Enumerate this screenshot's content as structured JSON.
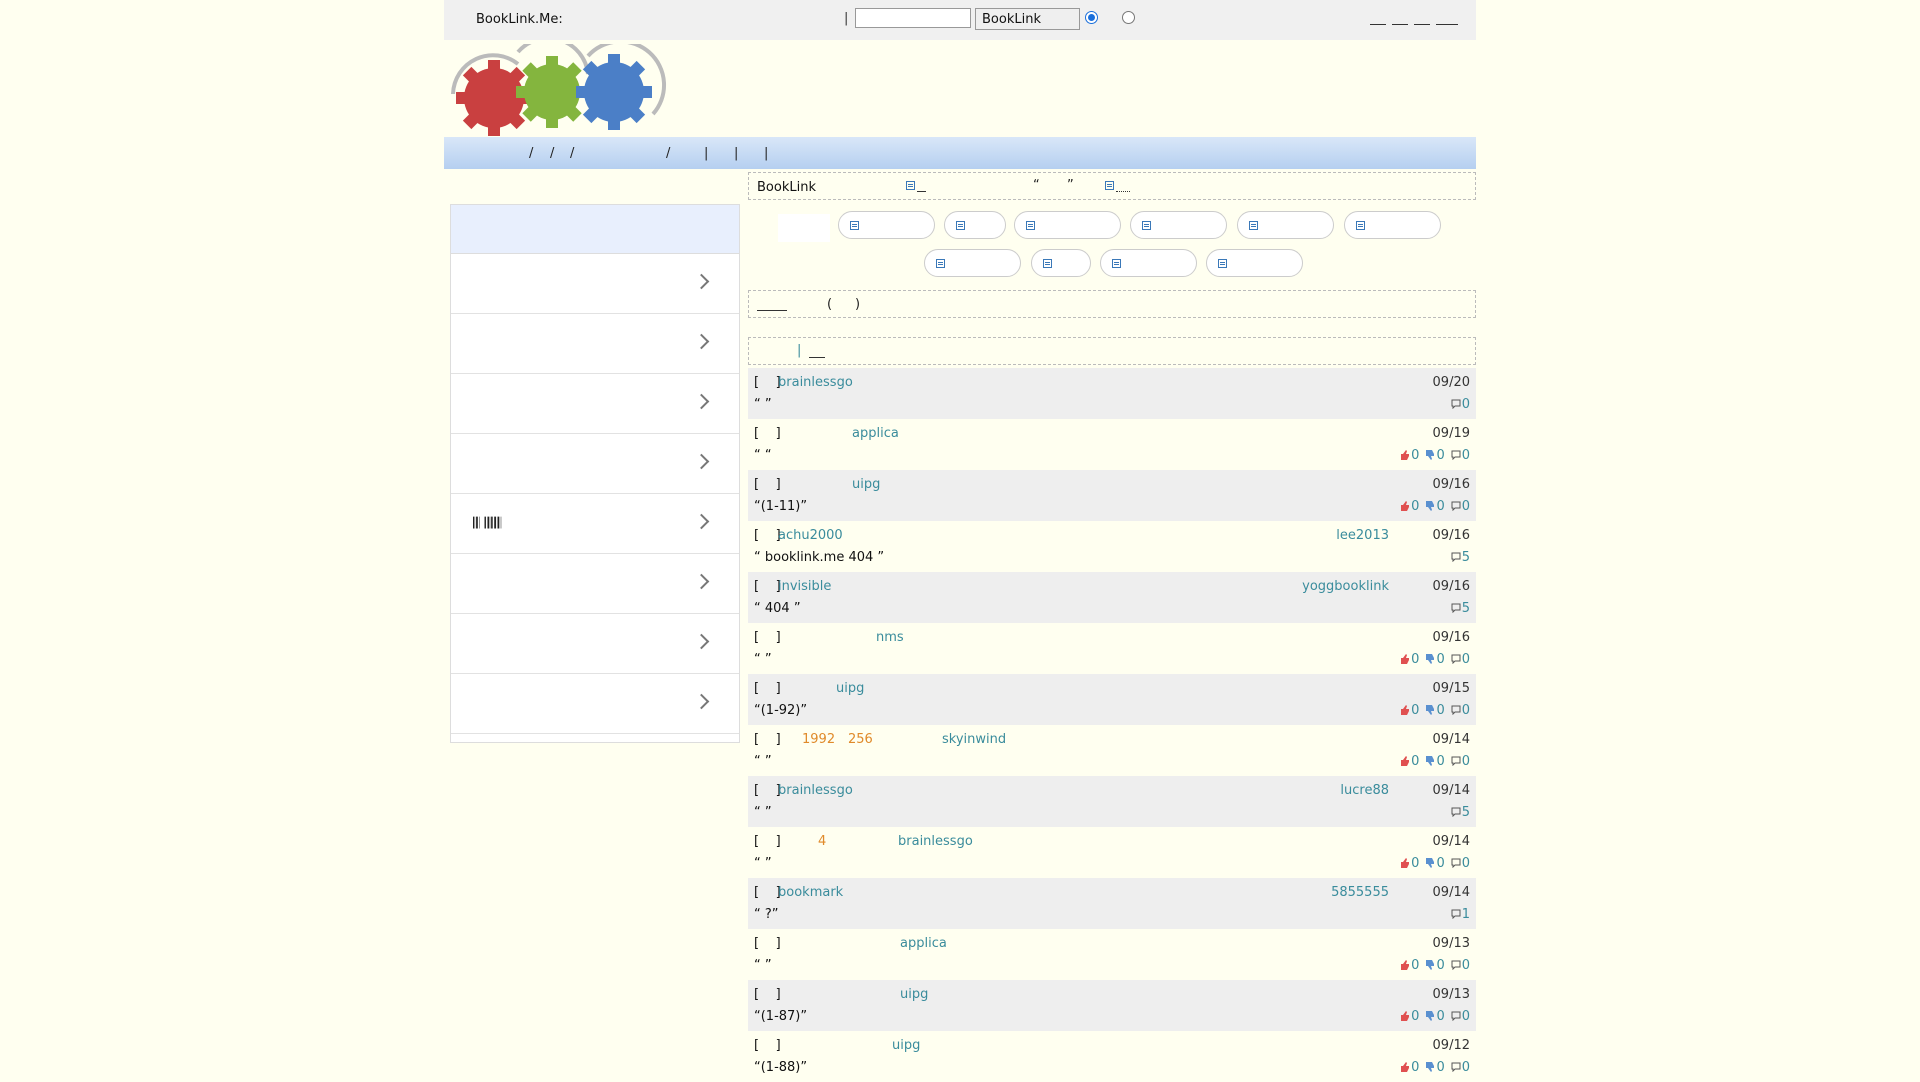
{
  "topbar": {
    "site_label": "BookLink.Me:",
    "separator": "|",
    "search_value": "",
    "search_button": "BookLink"
  },
  "notice": {
    "text": "BookLink"
  },
  "sidebar": {
    "items": [
      {
        "label": ""
      },
      {
        "label": ""
      },
      {
        "label": ""
      },
      {
        "label": ""
      },
      {
        "label": "𝄃𝄃 𝄃𝄃𝄃𝄃𝄃"
      },
      {
        "label": ""
      },
      {
        "label": ""
      },
      {
        "label": ""
      }
    ]
  },
  "list": [
    {
      "user_a": "brainlessgo",
      "user_b": "",
      "date": "09/20",
      "quote": "“                          ”",
      "votes": false,
      "up": "",
      "down": "",
      "comments": "0"
    },
    {
      "user_a": "applica",
      "user_b": "",
      "date": "09/19",
      "quote": "“      “",
      "votes": true,
      "up": "0",
      "down": "0",
      "comments": "0"
    },
    {
      "user_a": "uipg",
      "user_b": "",
      "date": "09/16",
      "quote": "“(1-11)”",
      "votes": true,
      "up": "0",
      "down": "0",
      "comments": "0"
    },
    {
      "user_a": "achu2000",
      "user_b": "lee2013",
      "date": "09/16",
      "quote": "“        booklink.me                    404     ”",
      "votes": false,
      "up": "",
      "down": "",
      "comments": "5"
    },
    {
      "user_a": "invisible",
      "user_b": "yoggbooklink",
      "date": "09/16",
      "quote": "“      404                              ”",
      "votes": false,
      "up": "",
      "down": "",
      "comments": "5"
    },
    {
      "user_a": "nms",
      "user_b": "",
      "date": "09/16",
      "quote": "“                                            ”",
      "votes": true,
      "up": "0",
      "down": "0",
      "comments": "0"
    },
    {
      "user_a": "uipg",
      "user_b": "",
      "date": "09/15",
      "quote": "“(1-92)”",
      "votes": true,
      "up": "0",
      "down": "0",
      "comments": "0"
    },
    {
      "user_a": "skyinwind",
      "user_b": "",
      "date": "09/14",
      "quote": "“        ”",
      "votes": true,
      "up": "0",
      "down": "0",
      "comments": "0",
      "orange1": "1992",
      "orange2": "256"
    },
    {
      "user_a": "brainlessgo",
      "user_b": "lucre88",
      "date": "09/14",
      "quote": "“                ”",
      "votes": false,
      "up": "",
      "down": "",
      "comments": "5"
    },
    {
      "user_a": "brainlessgo",
      "user_b": "",
      "date": "09/14",
      "quote": "“                                                            ”",
      "votes": true,
      "up": "0",
      "down": "0",
      "comments": "0",
      "orange1": "4"
    },
    {
      "user_a": "bookmark",
      "user_b": "5855555",
      "date": "09/14",
      "quote": "“                   ?”",
      "votes": false,
      "up": "",
      "down": "",
      "comments": "1"
    },
    {
      "user_a": "applica",
      "user_b": "",
      "date": "09/13",
      "quote": "“                                    ”",
      "votes": true,
      "up": "0",
      "down": "0",
      "comments": "0"
    },
    {
      "user_a": "uipg",
      "user_b": "",
      "date": "09/13",
      "quote": "“(1-87)”",
      "votes": true,
      "up": "0",
      "down": "0",
      "comments": "0"
    },
    {
      "user_a": "uipg",
      "user_b": "",
      "date": "09/12",
      "quote": "“(1-88)”",
      "votes": true,
      "up": "0",
      "down": "0",
      "comments": "0"
    }
  ]
}
